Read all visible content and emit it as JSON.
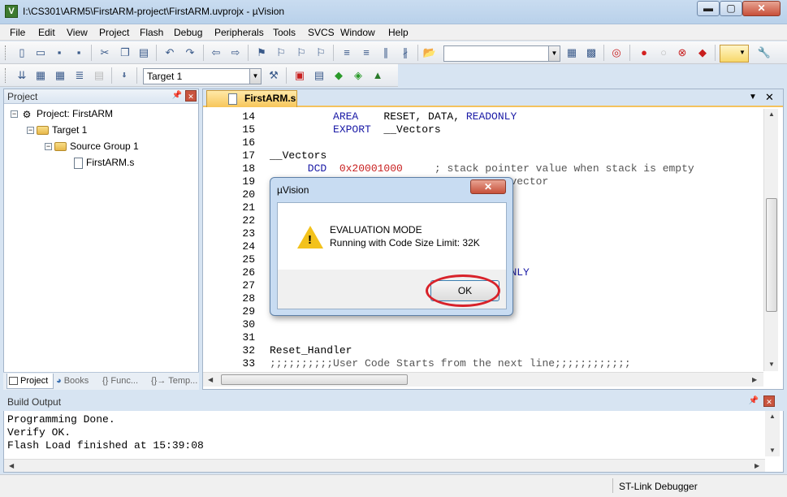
{
  "window": {
    "title": "I:\\CS301\\ARM5\\FirstARM-project\\FirstARM.uvprojx - µVision",
    "min": "▬",
    "max": "▢",
    "close": "✕",
    "app_icon": "V"
  },
  "menu": [
    "File",
    "Edit",
    "View",
    "Project",
    "Flash",
    "Debug",
    "Peripherals",
    "Tools",
    "SVCS",
    "Window",
    "Help"
  ],
  "toolbar": {
    "search_value": "",
    "target_value": "Target 1"
  },
  "project_panel": {
    "title": "Project",
    "tree": [
      {
        "label": "Project: FirstARM"
      },
      {
        "label": "Target 1"
      },
      {
        "label": "Source Group 1"
      },
      {
        "label": "FirstARM.s"
      }
    ],
    "tabs": [
      "Project",
      "Books",
      "{} Func...",
      "{}→ Temp..."
    ]
  },
  "editor": {
    "tab_label": "FirstARM.s",
    "lines": [
      {
        "n": "14",
        "t": [
          [
            "kw",
            "          AREA"
          ],
          [
            "",
            "    RESET, DATA, "
          ],
          [
            "kw",
            "READONLY"
          ]
        ]
      },
      {
        "n": "15",
        "t": [
          [
            "kw",
            "          EXPORT"
          ],
          [
            "",
            "  __Vectors"
          ]
        ]
      },
      {
        "n": "16",
        "t": []
      },
      {
        "n": "17",
        "t": [
          [
            "",
            "__Vectors"
          ]
        ]
      },
      {
        "n": "18",
        "t": [
          [
            "kw",
            "      DCD"
          ],
          [
            "",
            "  "
          ],
          [
            "num",
            "0x20001000"
          ],
          [
            "",
            "     "
          ],
          [
            "cmt",
            "; stack pointer value when stack is empty"
          ]
        ]
      },
      {
        "n": "19",
        "t": [
          [
            "",
            "                                      "
          ],
          [
            "cmt",
            "vector"
          ]
        ]
      },
      {
        "n": "20",
        "t": []
      },
      {
        "n": "21",
        "t": []
      },
      {
        "n": "22",
        "t": []
      },
      {
        "n": "23",
        "t": []
      },
      {
        "n": "24",
        "t": []
      },
      {
        "n": "25",
        "t": []
      },
      {
        "n": "26",
        "t": [
          [
            "",
            "                                      "
          ],
          [
            "kw",
            "NLY"
          ]
        ]
      },
      {
        "n": "27",
        "t": []
      },
      {
        "n": "28",
        "t": []
      },
      {
        "n": "29",
        "t": []
      },
      {
        "n": "30",
        "t": []
      },
      {
        "n": "31",
        "t": []
      },
      {
        "n": "32",
        "t": [
          [
            "",
            "Reset_Handler"
          ]
        ]
      },
      {
        "n": "33",
        "t": [
          [
            "cmt",
            ";;;;;;;;;;User Code Starts from the next line;;;;;;;;;;;;"
          ]
        ]
      }
    ]
  },
  "build_output": {
    "title": "Build Output",
    "text": "Programming Done.\nVerify OK.\nFlash Load finished at 15:39:08"
  },
  "status_bar": {
    "debugger": "ST-Link Debugger"
  },
  "dialog": {
    "title": "µVision",
    "close": "✕",
    "line1": "EVALUATION MODE",
    "line2": "Running with Code Size Limit: 32K",
    "ok": "OK",
    "icon": "warning-icon"
  }
}
